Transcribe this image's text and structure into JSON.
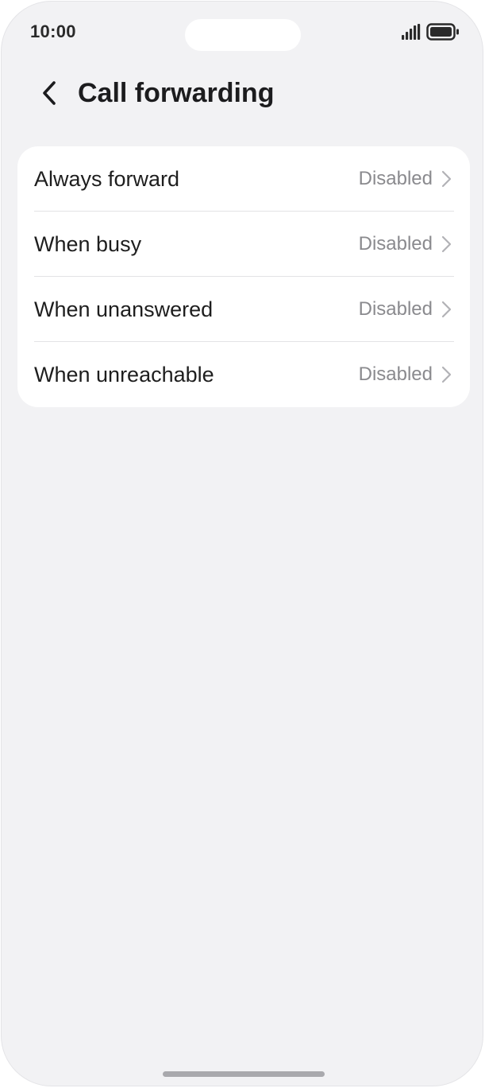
{
  "status_bar": {
    "time": "10:00"
  },
  "header": {
    "title": "Call forwarding",
    "back_icon": "chevron-left-icon"
  },
  "settings": {
    "rows": [
      {
        "label": "Always forward",
        "value": "Disabled"
      },
      {
        "label": "When busy",
        "value": "Disabled"
      },
      {
        "label": "When unanswered",
        "value": "Disabled"
      },
      {
        "label": "When unreachable",
        "value": "Disabled"
      }
    ]
  },
  "colors": {
    "background": "#f2f2f4",
    "card": "#ffffff",
    "text_primary": "#1e1e1e",
    "text_secondary": "#8a8a8e"
  }
}
